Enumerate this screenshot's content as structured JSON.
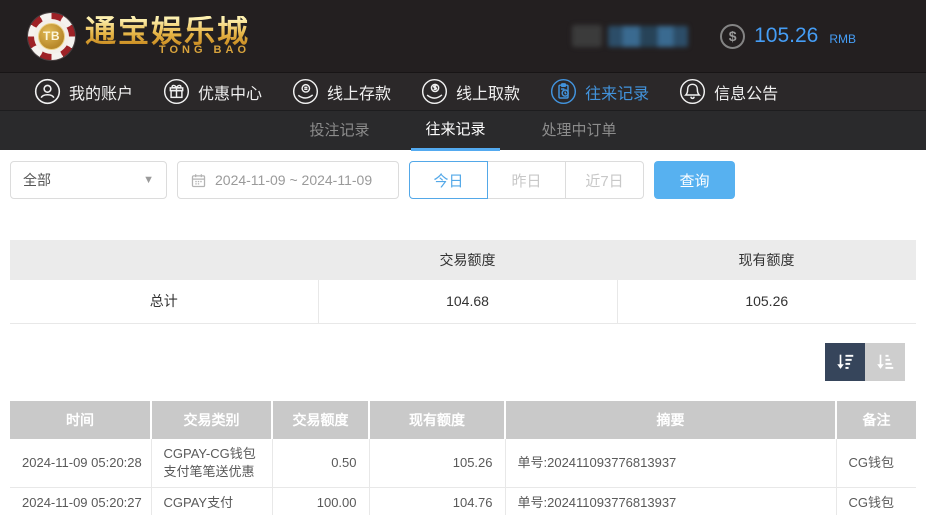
{
  "brand": {
    "chip": "TB",
    "name": "通宝娱乐城",
    "subtitle": "TONG BAO"
  },
  "topbar": {
    "currency_symbol": "$",
    "balance": "105.26",
    "currency": "RMB"
  },
  "nav": {
    "items": [
      {
        "label": "我的账户"
      },
      {
        "label": "优惠中心"
      },
      {
        "label": "线上存款"
      },
      {
        "label": "线上取款"
      },
      {
        "label": "往来记录"
      },
      {
        "label": "信息公告"
      }
    ]
  },
  "subtabs": {
    "items": [
      {
        "label": "投注记录"
      },
      {
        "label": "往来记录"
      },
      {
        "label": "处理中订单"
      }
    ]
  },
  "filters": {
    "type_select": {
      "value": "全部"
    },
    "date_range": {
      "value": "2024-11-09 ~ 2024-11-09"
    },
    "quick_ranges": [
      {
        "label": "今日"
      },
      {
        "label": "昨日"
      },
      {
        "label": "近7日"
      }
    ],
    "search_button": "查询"
  },
  "summary": {
    "col_transaction": "交易额度",
    "col_balance": "现有额度",
    "total_label": "总计",
    "total_transaction": "104.68",
    "total_balance": "105.26"
  },
  "records": {
    "columns": {
      "time": "时间",
      "type": "交易类别",
      "amount": "交易额度",
      "balance": "现有额度",
      "summary": "摘要",
      "remark": "备注"
    },
    "rows": [
      {
        "time": "2024-11-09 05:20:28",
        "type": "CGPAY-CG钱包支付笔笔送优惠",
        "amount": "0.50",
        "balance": "105.26",
        "summary": "单号:202411093776813937",
        "remark": "CG钱包"
      },
      {
        "time": "2024-11-09 05:20:27",
        "type": "CGPAY支付",
        "amount": "100.00",
        "balance": "104.76",
        "summary": "单号:202411093776813937",
        "remark": "CG钱包"
      }
    ]
  },
  "colors": {
    "accent_blue": "#459df5",
    "nav_active_blue": "#4293dc",
    "search_button_blue": "#57b1f0",
    "tab_underline_blue": "#53aaf0",
    "header_bg": "#231f20",
    "table_header_bg": "#c9c9c9",
    "sort_active_bg": "#36455b",
    "sort_inactive_bg": "#cecece"
  }
}
